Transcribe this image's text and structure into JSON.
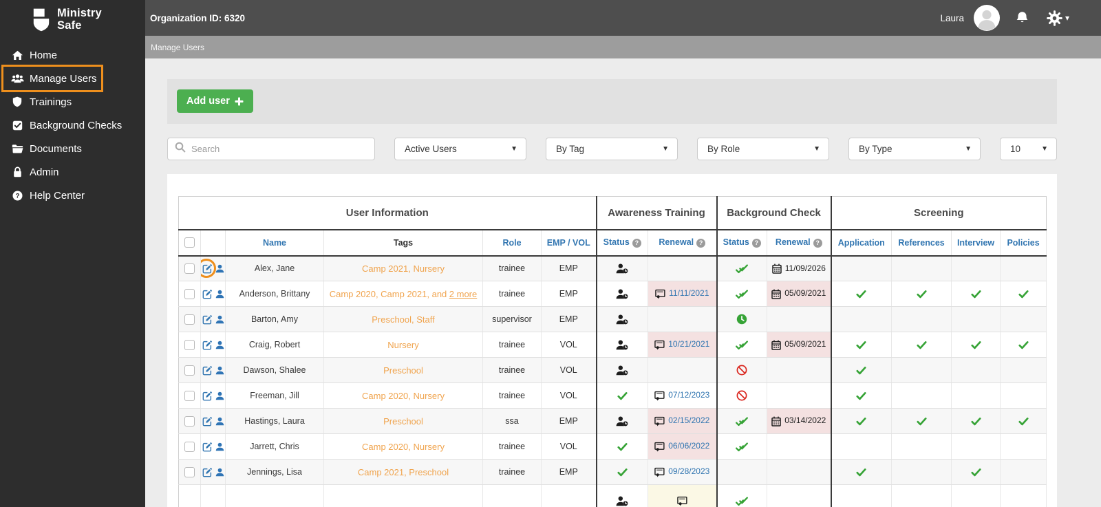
{
  "brand": {
    "line1": "Ministry",
    "line2": "Safe"
  },
  "topbar": {
    "org_id": "Organization ID: 6320",
    "user_name": "Laura"
  },
  "breadcrumb": "Manage Users",
  "sidebar": {
    "items": [
      {
        "label": "Home",
        "icon": "home-icon",
        "active": false
      },
      {
        "label": "Manage Users",
        "icon": "users-icon",
        "active": true
      },
      {
        "label": "Trainings",
        "icon": "shield-icon",
        "active": false
      },
      {
        "label": "Background Checks",
        "icon": "check-square-icon",
        "active": false
      },
      {
        "label": "Documents",
        "icon": "folder-icon",
        "active": false
      },
      {
        "label": "Admin",
        "icon": "lock-icon",
        "active": false
      },
      {
        "label": "Help Center",
        "icon": "question-circle-icon",
        "active": false
      }
    ]
  },
  "toolbar": {
    "add_user_label": "Add user"
  },
  "filters": {
    "search_placeholder": "Search",
    "dropdowns": [
      "Active Users",
      "By Tag",
      "By Role",
      "By Type"
    ],
    "page_size": "10"
  },
  "colors": {
    "accent_orange_annotation": "#ee8f1d",
    "tag_orange": "#f0a44e",
    "link_blue": "#3276b1",
    "status_green": "#36a336",
    "status_red": "#da251d",
    "expired_bg": "#f4e1e1",
    "pending_bg": "#fbf8e5",
    "add_button_green": "#4caf50"
  },
  "table": {
    "groups": {
      "user_info": "User Information",
      "awareness": "Awareness Training",
      "background": "Background Check",
      "screening": "Screening"
    },
    "columns": {
      "name": "Name",
      "tags": "Tags",
      "role": "Role",
      "emp_vol": "EMP / VOL",
      "status": "Status",
      "renewal": "Renewal",
      "application": "Application",
      "references": "References",
      "interview": "Interview",
      "policies": "Policies"
    },
    "rows": [
      {
        "name": "Alex, Jane",
        "tags": "Camp 2021, Nursery",
        "more": null,
        "role": "trainee",
        "type": "EMP",
        "at_status": "user-clock",
        "at_renewal": null,
        "at_expired": false,
        "bgc_status": "double-check",
        "bgc_renewal": "11/09/2026",
        "bgc_expired": false,
        "screening": [
          false,
          false,
          false,
          false
        ],
        "edit_circled": true
      },
      {
        "name": "Anderson, Brittany",
        "tags": "Camp 2020, Camp 2021, and",
        "more": "2 more",
        "role": "trainee",
        "type": "EMP",
        "at_status": "user-clock",
        "at_renewal": "11/11/2021",
        "at_expired": true,
        "bgc_status": "double-check",
        "bgc_renewal": "05/09/2021",
        "bgc_expired": true,
        "screening": [
          true,
          true,
          true,
          true
        ],
        "edit_circled": false
      },
      {
        "name": "Barton, Amy",
        "tags": "Preschool, Staff",
        "more": null,
        "role": "supervisor",
        "type": "EMP",
        "at_status": "user-clock",
        "at_renewal": null,
        "at_expired": false,
        "bgc_status": "clock",
        "bgc_renewal": null,
        "bgc_expired": false,
        "screening": [
          false,
          false,
          false,
          false
        ],
        "edit_circled": false
      },
      {
        "name": "Craig, Robert",
        "tags": "Nursery",
        "more": null,
        "role": "trainee",
        "type": "VOL",
        "at_status": "user-clock",
        "at_renewal": "10/21/2021",
        "at_expired": true,
        "bgc_status": "double-check",
        "bgc_renewal": "05/09/2021",
        "bgc_expired": true,
        "screening": [
          true,
          true,
          true,
          true
        ],
        "edit_circled": false
      },
      {
        "name": "Dawson, Shalee",
        "tags": "Preschool",
        "more": null,
        "role": "trainee",
        "type": "VOL",
        "at_status": "user-clock",
        "at_renewal": null,
        "at_expired": false,
        "bgc_status": "ban",
        "bgc_renewal": null,
        "bgc_expired": false,
        "screening": [
          true,
          false,
          false,
          false
        ],
        "edit_circled": false
      },
      {
        "name": "Freeman, Jill",
        "tags": "Camp 2020, Nursery",
        "more": null,
        "role": "trainee",
        "type": "VOL",
        "at_status": "check",
        "at_renewal": "07/12/2023",
        "at_expired": false,
        "bgc_status": "ban",
        "bgc_renewal": null,
        "bgc_expired": false,
        "screening": [
          true,
          false,
          false,
          false
        ],
        "edit_circled": false
      },
      {
        "name": "Hastings, Laura",
        "tags": "Preschool",
        "more": null,
        "role": "ssa",
        "type": "EMP",
        "at_status": "user-clock",
        "at_renewal": "02/15/2022",
        "at_expired": true,
        "bgc_status": "double-check",
        "bgc_renewal": "03/14/2022",
        "bgc_expired": true,
        "screening": [
          true,
          true,
          true,
          true
        ],
        "edit_circled": false
      },
      {
        "name": "Jarrett, Chris",
        "tags": "Camp 2020, Nursery",
        "more": null,
        "role": "trainee",
        "type": "VOL",
        "at_status": "check",
        "at_renewal": "06/06/2022",
        "at_expired": true,
        "bgc_status": "double-check",
        "bgc_renewal": null,
        "bgc_expired": false,
        "screening": [
          false,
          false,
          false,
          false
        ],
        "edit_circled": false
      },
      {
        "name": "Jennings, Lisa",
        "tags": "Camp 2021, Preschool",
        "more": null,
        "role": "trainee",
        "type": "EMP",
        "at_status": "check",
        "at_renewal": "09/28/2023",
        "at_expired": false,
        "bgc_status": "none",
        "bgc_renewal": null,
        "bgc_expired": false,
        "screening": [
          true,
          false,
          true,
          false
        ],
        "edit_circled": false
      }
    ],
    "partial_row": {
      "at_status": "user-clock",
      "at_renewal_pending": true,
      "bgc_status": "double-check"
    }
  }
}
